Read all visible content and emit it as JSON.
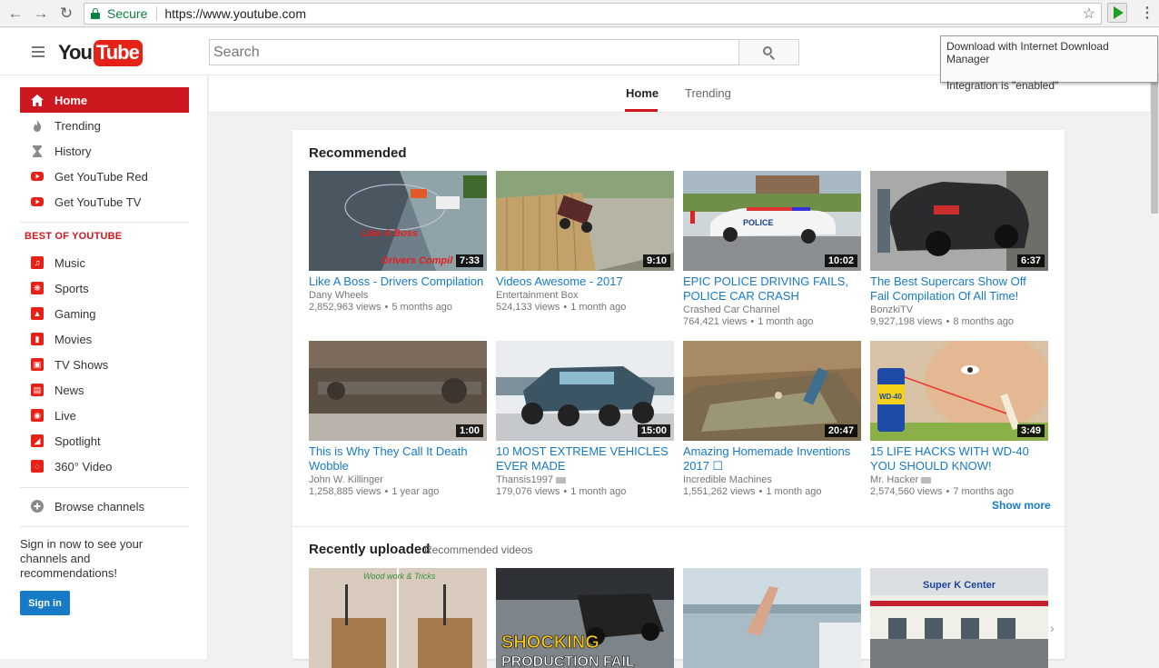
{
  "browser": {
    "secure_label": "Secure",
    "url": "https://www.youtube.com",
    "idm_line1": "Download with Internet Download Manager",
    "idm_line2": "Integration is \"enabled\""
  },
  "masthead": {
    "logo_you": "You",
    "logo_tube": "Tube",
    "search_placeholder": "Search"
  },
  "sidebar": {
    "main_items": [
      {
        "label": "Home",
        "icon": "home-icon"
      },
      {
        "label": "Trending",
        "icon": "flame-icon"
      },
      {
        "label": "History",
        "icon": "hourglass-icon"
      },
      {
        "label": "Get YouTube Red",
        "icon": "youtube-red-icon"
      },
      {
        "label": "Get YouTube TV",
        "icon": "youtube-tv-icon"
      }
    ],
    "section_title": "BEST OF YOUTUBE",
    "best_items": [
      {
        "label": "Music",
        "icon": "music-icon"
      },
      {
        "label": "Sports",
        "icon": "sports-icon"
      },
      {
        "label": "Gaming",
        "icon": "gaming-icon"
      },
      {
        "label": "Movies",
        "icon": "movies-icon"
      },
      {
        "label": "TV Shows",
        "icon": "tv-icon"
      },
      {
        "label": "News",
        "icon": "news-icon"
      },
      {
        "label": "Live",
        "icon": "live-icon"
      },
      {
        "label": "Spotlight",
        "icon": "spotlight-icon"
      },
      {
        "label": "360° Video",
        "icon": "360-icon"
      }
    ],
    "browse_channels": "Browse channels",
    "signin_text": "Sign in now to see your channels and recommendations!",
    "signin_button": "Sign in"
  },
  "tabs": [
    {
      "label": "Home"
    },
    {
      "label": "Trending"
    }
  ],
  "recommended": {
    "title": "Recommended",
    "show_more": "Show more",
    "videos": [
      {
        "title": "Like A Boss - Drivers Compilation",
        "channel": "Dany Wheels",
        "views": "2,852,963 views",
        "age": "5 months ago",
        "duration": "7:33",
        "overlay": "Like A Boss",
        "overlay2": "Drivers Compil"
      },
      {
        "title": "Videos Awesome - 2017",
        "channel": "Entertainment Box",
        "views": "524,133 views",
        "age": "1 month ago",
        "duration": "9:10"
      },
      {
        "title": "EPIC POLICE DRIVING FAILS, POLICE CAR CRASH",
        "channel": "Crashed Car Channel",
        "views": "764,421 views",
        "age": "1 month ago",
        "duration": "10:02",
        "overlay": "POLICE"
      },
      {
        "title": "The Best Supercars Show Off Fail Compilation Of All Time!",
        "channel": "BonzkiTV",
        "views": "9,927,198 views",
        "age": "8 months ago",
        "duration": "6:37"
      },
      {
        "title": "This is Why They Call It Death Wobble",
        "channel": "John W. Killinger",
        "views": "1,258,885 views",
        "age": "1 year ago",
        "duration": "1:00"
      },
      {
        "title": "10 MOST EXTREME VEHICLES EVER MADE",
        "channel": "Thansis1997",
        "views": "179,076 views",
        "age": "1 month ago",
        "duration": "15:00"
      },
      {
        "title": "Amazing Homemade Inventions 2017 ☐",
        "channel": "Incredible Machines",
        "views": "1,551,262 views",
        "age": "1 month ago",
        "duration": "20:47"
      },
      {
        "title": "15 LIFE HACKS WITH WD-40 YOU SHOULD KNOW!",
        "channel": "Mr. Hacker",
        "views": "2,574,560 views",
        "age": "7 months ago",
        "duration": "3:49",
        "overlay": "WD-40"
      }
    ]
  },
  "recent": {
    "title": "Recently uploaded",
    "subtitle": "Recommended videos",
    "thumbs": [
      {
        "overlay": "Wood work & Tricks"
      },
      {
        "overlay": "SHOCKING",
        "overlay2": "PRODUCTION FAIL"
      },
      {
        "overlay": ""
      },
      {
        "overlay": "Super K Center"
      }
    ]
  }
}
